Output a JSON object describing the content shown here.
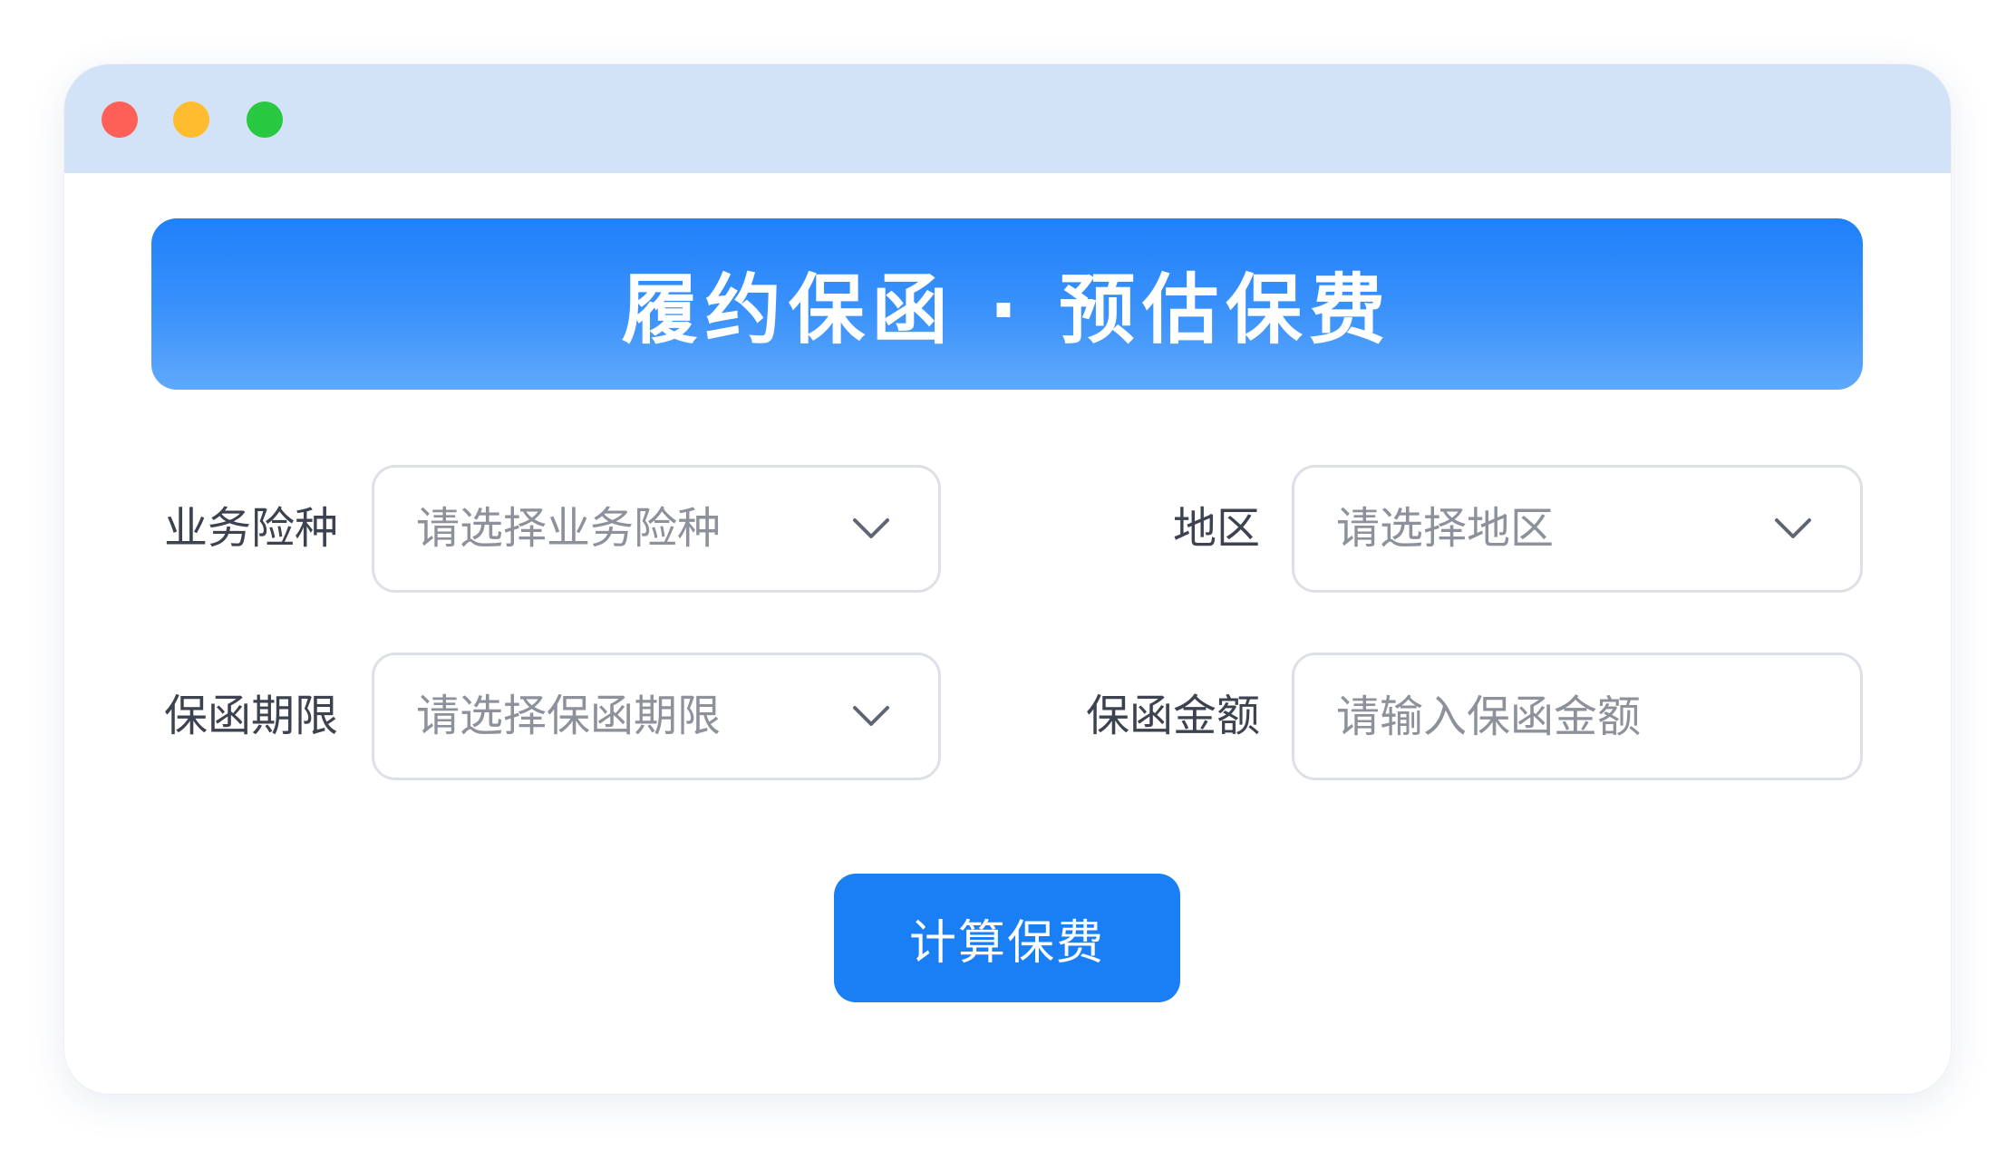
{
  "window": {
    "controls": [
      {
        "name": "close",
        "color": "#fe5f57"
      },
      {
        "name": "minimize",
        "color": "#febc2e"
      },
      {
        "name": "maximize",
        "color": "#28c840"
      }
    ],
    "titlebar_color": "#d3e3f7"
  },
  "banner": {
    "title": "履约保函 · 预估保费",
    "gradient": [
      "#1f80fa",
      "#5fa9fb"
    ]
  },
  "form": {
    "fields": [
      {
        "label": "业务险种",
        "placeholder": "请选择业务险种",
        "type": "select",
        "icon": "chevron-down-icon"
      },
      {
        "label": "地区",
        "placeholder": "请选择地区",
        "type": "select",
        "icon": "chevron-down-icon"
      },
      {
        "label": "保函期限",
        "placeholder": "请选择保函期限",
        "type": "select",
        "icon": "chevron-down-icon"
      },
      {
        "label": "保函金额",
        "placeholder": "请输入保函金额",
        "type": "input",
        "value": ""
      }
    ]
  },
  "submit": {
    "label": "计算保费",
    "color": "#1a7ff5"
  }
}
